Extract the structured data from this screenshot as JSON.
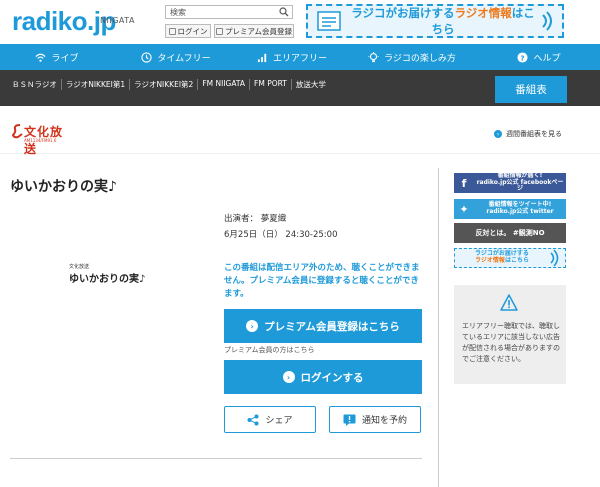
{
  "header": {
    "logo": "radiko.jp",
    "area": "NIIGATA",
    "search_placeholder": "検索",
    "login_label": "ログイン",
    "premium_label": "プレミアム会員登録",
    "banner": {
      "prefix": "ラジコがお届けする",
      "emphasis": "ラジオ情報",
      "suffix": "はこちら"
    }
  },
  "nav": {
    "items": [
      {
        "label": "ライブ",
        "icon": "wifi-icon"
      },
      {
        "label": "タイムフリー",
        "icon": "clock-icon"
      },
      {
        "label": "エリアフリー",
        "icon": "signal-icon"
      },
      {
        "label": "ラジコの楽しみ方",
        "icon": "bulb-icon"
      },
      {
        "label": "ヘルプ",
        "icon": "question-icon"
      }
    ]
  },
  "stations": {
    "items": [
      "ＢＳＮラジオ",
      "ラジオNIKKEI第1",
      "ラジオNIKKEI第2",
      "FM NIIGATA",
      "FM PORT",
      "放送大学"
    ],
    "program_table_label": "番組表"
  },
  "station_head": {
    "logo_text": "文化放送",
    "logo_sub": "AM1134/FM91.6",
    "weekly_link": "週間番組表を見る"
  },
  "program": {
    "title": "ゆいかおりの実♪",
    "thumb_station": "文化放送",
    "thumb_title": "ゆいかおりの実♪",
    "cast": "出演者：  夢夏織",
    "datetime": "6月25日（日） 24:30-25:00",
    "notice": "この番組は配信エリア外のため、聴くことができません。プレミアム会員に登録すると聴くことができます。",
    "register_button": "プレミアム会員登録はこちら",
    "premium_note": "プレミアム会員の方はこちら",
    "login_button": "ログインする",
    "share_button": "シェア",
    "notify_button": "通知を予約"
  },
  "sidebar": {
    "facebook_line1": "番組情報が届く!",
    "facebook_line2": "radiko.jp公式 facebookページ",
    "twitter_line1": "番組情報をツイート中!",
    "twitter_line2": "radiko.jp公式 twitter",
    "banner3_text": "反対とは。 #観測NO",
    "info_line1": "ラジコがお届けする",
    "info_emphasis": "ラジオ情報",
    "info_suffix": "はこちら",
    "area_free_notice": "エリアフリー聴取では、聴取しているエリアに該当しない広告が配信される場合がありますのでご注意ください。"
  },
  "colors": {
    "accent": "#1e9ad9",
    "dark_bar": "#3a3a3a",
    "orange": "#ee7a1d",
    "station_red": "#d2321a"
  }
}
